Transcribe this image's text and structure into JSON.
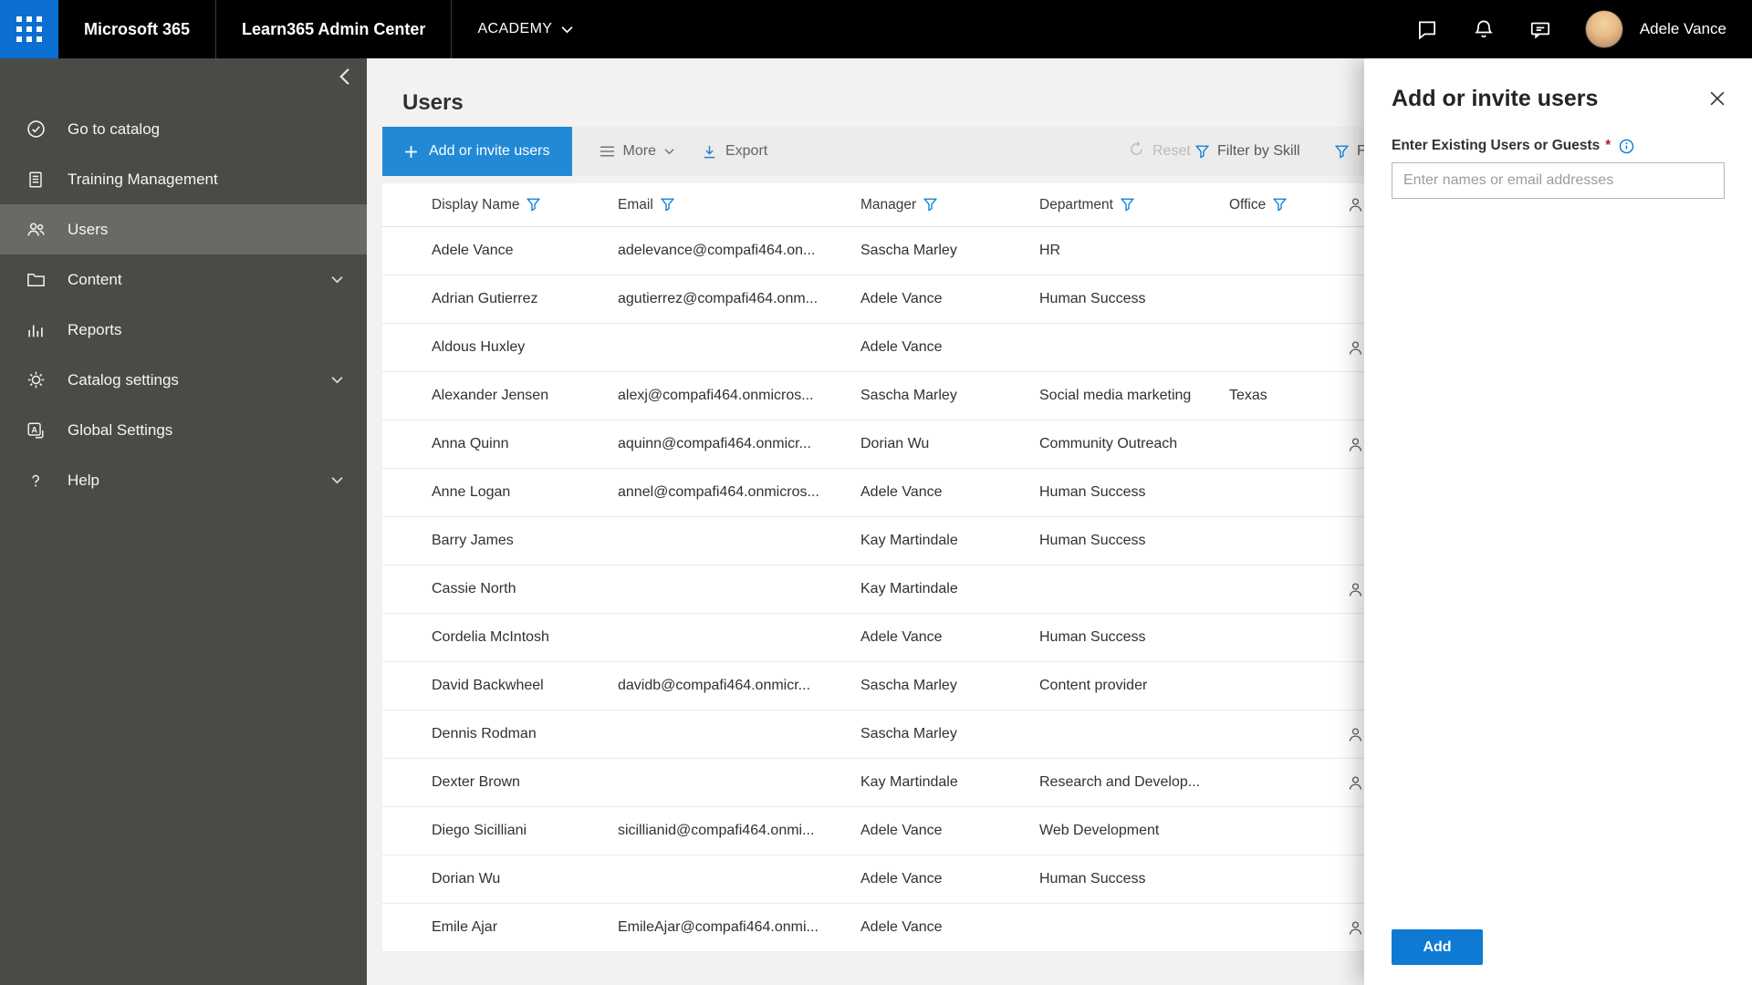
{
  "topbar": {
    "brand": "Microsoft 365",
    "app": "Learn365 Admin Center",
    "tenant": "ACADEMY",
    "user_name": "Adele Vance",
    "action_icons": [
      "chat-icon",
      "bell-icon",
      "feedback-icon"
    ]
  },
  "sidebar": {
    "items": [
      {
        "label": "Go to catalog",
        "icon": "check-circle",
        "selected": false,
        "expandable": false
      },
      {
        "label": "Training Management",
        "icon": "document",
        "selected": false,
        "expandable": false
      },
      {
        "label": "Users",
        "icon": "people",
        "selected": true,
        "expandable": false
      },
      {
        "label": "Content",
        "icon": "folder",
        "selected": false,
        "expandable": true
      },
      {
        "label": "Reports",
        "icon": "bar-chart",
        "selected": false,
        "expandable": false
      },
      {
        "label": "Catalog settings",
        "icon": "gear",
        "selected": false,
        "expandable": true
      },
      {
        "label": "Global Settings",
        "icon": "translate",
        "selected": false,
        "expandable": false
      },
      {
        "label": "Help",
        "icon": "question",
        "selected": false,
        "expandable": true
      }
    ]
  },
  "main": {
    "title": "Users",
    "toolbar": {
      "add_button": "Add or invite users",
      "more": "More",
      "export": "Export",
      "reset": "Reset",
      "filter_by_skill": "Filter by Skill",
      "filter_partial": "F"
    },
    "table": {
      "columns": [
        "Display Name",
        "Email",
        "Manager",
        "Department",
        "Office"
      ],
      "rows": [
        {
          "name": "Adele Vance",
          "email": "adelevance@compafi464.on...",
          "manager": "Sascha Marley",
          "department": "HR",
          "office": "",
          "badge": false
        },
        {
          "name": "Adrian Gutierrez",
          "email": "agutierrez@compafi464.onm...",
          "manager": "Adele Vance",
          "department": "Human Success",
          "office": "",
          "badge": false
        },
        {
          "name": "Aldous Huxley",
          "email": "",
          "manager": "Adele Vance",
          "department": "",
          "office": "",
          "badge": true
        },
        {
          "name": "Alexander Jensen",
          "email": "alexj@compafi464.onmicros...",
          "manager": "Sascha Marley",
          "department": "Social media marketing",
          "office": "Texas",
          "badge": false
        },
        {
          "name": "Anna Quinn",
          "email": "aquinn@compafi464.onmicr...",
          "manager": "Dorian Wu",
          "department": "Community Outreach",
          "office": "",
          "badge": true
        },
        {
          "name": "Anne Logan",
          "email": "annel@compafi464.onmicros...",
          "manager": "Adele Vance",
          "department": "Human Success",
          "office": "",
          "badge": false
        },
        {
          "name": "Barry James",
          "email": "",
          "manager": "Kay Martindale",
          "department": "Human Success",
          "office": "",
          "badge": false
        },
        {
          "name": "Cassie North",
          "email": "",
          "manager": "Kay Martindale",
          "department": "",
          "office": "",
          "badge": true
        },
        {
          "name": "Cordelia McIntosh",
          "email": "",
          "manager": "Adele Vance",
          "department": "Human Success",
          "office": "",
          "badge": false
        },
        {
          "name": "David Backwheel",
          "email": "davidb@compafi464.onmicr...",
          "manager": "Sascha Marley",
          "department": "Content provider",
          "office": "",
          "badge": false
        },
        {
          "name": "Dennis Rodman",
          "email": "",
          "manager": "Sascha Marley",
          "department": "",
          "office": "",
          "badge": true
        },
        {
          "name": "Dexter Brown",
          "email": "",
          "manager": "Kay Martindale",
          "department": "Research and Develop...",
          "office": "",
          "badge": true
        },
        {
          "name": "Diego Sicilliani",
          "email": "sicillianid@compafi464.onmi...",
          "manager": "Adele Vance",
          "department": "Web Development",
          "office": "",
          "badge": false
        },
        {
          "name": "Dorian Wu",
          "email": "",
          "manager": "Adele Vance",
          "department": "Human Success",
          "office": "",
          "badge": false
        },
        {
          "name": "Emile Ajar",
          "email": "EmileAjar@compafi464.onmi...",
          "manager": "Adele Vance",
          "department": "",
          "office": "",
          "badge": true
        }
      ]
    }
  },
  "panel": {
    "title": "Add or invite users",
    "field_label": "Enter Existing Users or Guests",
    "required_marker": "*",
    "input_placeholder": "Enter names or email addresses",
    "add_button": "Add"
  },
  "colors": {
    "accent_blue": "#0078d4",
    "toolbar_button_blue": "#2189d6",
    "sidebar_gray": "#4a4a47",
    "required_red": "#a4262c"
  }
}
